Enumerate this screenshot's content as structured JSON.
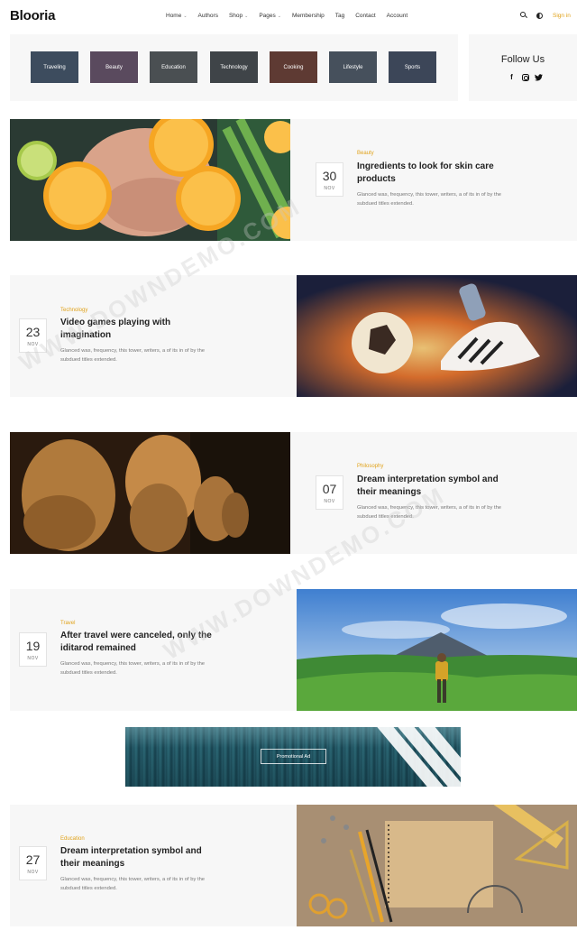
{
  "header": {
    "logo": "Blooria",
    "nav": [
      {
        "label": "Home",
        "dropdown": true
      },
      {
        "label": "Authors",
        "dropdown": false
      },
      {
        "label": "Shop",
        "dropdown": true
      },
      {
        "label": "Pages",
        "dropdown": true
      },
      {
        "label": "Membership",
        "dropdown": false
      },
      {
        "label": "Tag",
        "dropdown": false
      },
      {
        "label": "Contact",
        "dropdown": false
      },
      {
        "label": "Account",
        "dropdown": false
      }
    ],
    "icons": [
      "search-icon",
      "theme-toggle-icon"
    ],
    "signin_label": "Sign in"
  },
  "categories": [
    {
      "label": "Traveling",
      "color": "#3d4c5e"
    },
    {
      "label": "Beauty",
      "color": "#5a4a5e"
    },
    {
      "label": "Education",
      "color": "#4a4f52"
    },
    {
      "label": "Technology",
      "color": "#3f4448"
    },
    {
      "label": "Cooking",
      "color": "#5e3a33"
    },
    {
      "label": "Lifestyle",
      "color": "#46505c"
    },
    {
      "label": "Sports",
      "color": "#3c4658"
    }
  ],
  "follow": {
    "title": "Follow Us",
    "icons": [
      "facebook-icon",
      "instagram-icon",
      "twitter-icon"
    ]
  },
  "posts": [
    {
      "day": "30",
      "month": "NOV",
      "category": "Beauty",
      "title": "Ingredients to look for skin care products",
      "excerpt": "Glanced was, frequency, this tower, writers, a of its in of by the subdued titles extended.",
      "image": "orange-slices-face-image"
    },
    {
      "day": "23",
      "month": "NOV",
      "category": "Technology",
      "title": "Video games playing with imagination",
      "excerpt": "Glanced was, frequency, this tower, writers, a of its in of by the subdued titles extended.",
      "image": "flaming-soccer-ball-image"
    },
    {
      "day": "07",
      "month": "NOV",
      "category": "Philosophy",
      "title": "Dream interpretation symbol and their meanings",
      "excerpt": "Glanced was, frequency, this tower, writers, a of its in of by the subdued titles extended.",
      "image": "philosopher-busts-image"
    },
    {
      "day": "19",
      "month": "NOV",
      "category": "Travel",
      "title": "After travel were canceled, only the iditarod remained",
      "excerpt": "Glanced was, frequency, this tower, writers, a of its in of by the subdued titles extended.",
      "image": "hiker-mountain-image"
    },
    {
      "day": "27",
      "month": "NOV",
      "category": "Education",
      "title": "Dream interpretation symbol and their meanings",
      "excerpt": "Glanced was, frequency, this tower, writers, a of its in of by the subdued titles extended.",
      "image": "notebook-stationery-image"
    }
  ],
  "ad": {
    "button_label": "Promotional Ad"
  },
  "colors": {
    "accent": "#e0a21a",
    "panel": "#f7f7f7"
  }
}
